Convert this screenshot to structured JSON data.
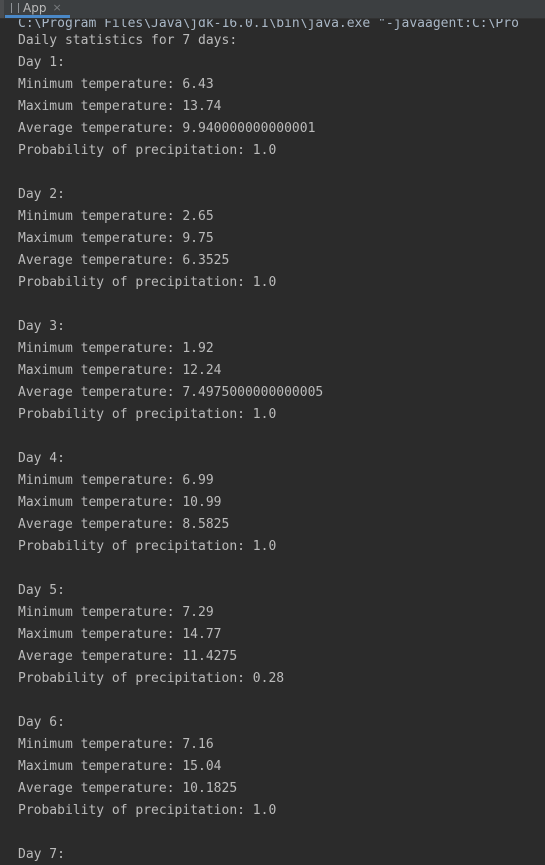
{
  "tab": {
    "label": "App",
    "close_glyph": "×"
  },
  "console": {
    "command": "C:\\Program Files\\Java\\jdk-16.0.1\\bin\\java.exe \"-javaagent:C:\\Pro",
    "header": "Daily statistics for 7 days:",
    "days": [
      {
        "day": "Day 1:",
        "min": "Minimum temperature: 6.43",
        "max": "Maximum temperature: 13.74",
        "avg": "Average temperature: 9.940000000000001",
        "prob": "Probability of precipitation: 1.0"
      },
      {
        "day": "Day 2:",
        "min": "Minimum temperature: 2.65",
        "max": "Maximum temperature: 9.75",
        "avg": "Average temperature: 6.3525",
        "prob": "Probability of precipitation: 1.0"
      },
      {
        "day": "Day 3:",
        "min": "Minimum temperature: 1.92",
        "max": "Maximum temperature: 12.24",
        "avg": "Average temperature: 7.4975000000000005",
        "prob": "Probability of precipitation: 1.0"
      },
      {
        "day": "Day 4:",
        "min": "Minimum temperature: 6.99",
        "max": "Maximum temperature: 10.99",
        "avg": "Average temperature: 8.5825",
        "prob": "Probability of precipitation: 1.0"
      },
      {
        "day": "Day 5:",
        "min": "Minimum temperature: 7.29",
        "max": "Maximum temperature: 14.77",
        "avg": "Average temperature: 11.4275",
        "prob": "Probability of precipitation: 0.28"
      },
      {
        "day": "Day 6:",
        "min": "Minimum temperature: 7.16",
        "max": "Maximum temperature: 15.04",
        "avg": "Average temperature: 10.1825",
        "prob": "Probability of precipitation: 1.0"
      },
      {
        "day": "Day 7:"
      }
    ]
  },
  "colors": {
    "background": "#2b2b2b",
    "tabbar": "#3c3f41",
    "text": "#bbbbbb",
    "tab_accent": "#4a88c7"
  }
}
